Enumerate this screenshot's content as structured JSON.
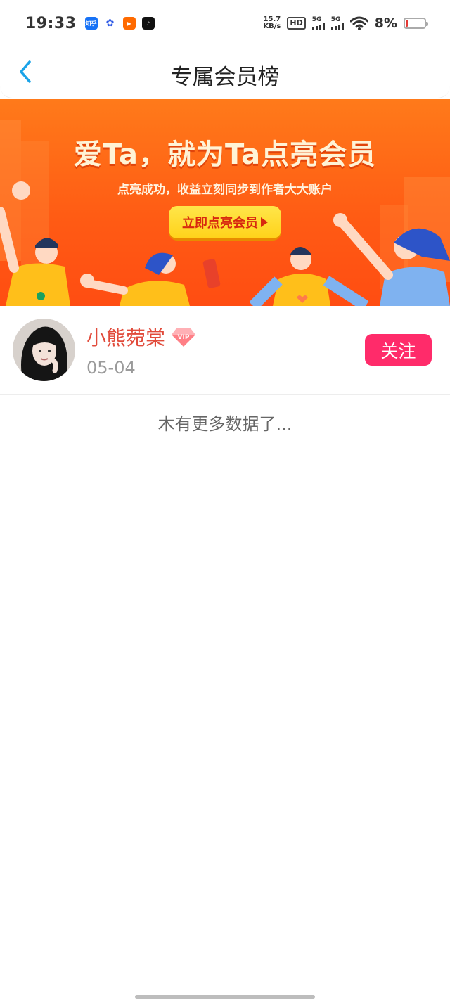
{
  "status_bar": {
    "time": "19:33",
    "app_icons": [
      {
        "name": "zhihu-app-icon",
        "glyph": "知乎",
        "color": "#1772f6"
      },
      {
        "name": "baidu-app-icon",
        "glyph": "✿",
        "color": "#2e5ae6"
      },
      {
        "name": "video-app-icon",
        "glyph": "▶",
        "color": "#ff6a00"
      },
      {
        "name": "tiktok-app-icon",
        "glyph": "♪",
        "color": "#111111"
      }
    ],
    "net_speed_value": "15.7",
    "net_speed_unit": "KB/s",
    "hd_label": "HD",
    "signal_1": "5G",
    "signal_2": "5G",
    "battery_percent": "8%"
  },
  "nav": {
    "title": "专属会员榜"
  },
  "banner": {
    "title": "爱Ta，就为Ta点亮会员",
    "subtitle": "点亮成功，收益立刻同步到作者大大账户",
    "cta_label": "立即点亮会员"
  },
  "members": [
    {
      "name": "小熊菀棠",
      "date": "05-04",
      "follow_label": "关注",
      "vip": "VIP"
    }
  ],
  "list_footer": "木有更多数据了...",
  "colors": {
    "accent_blue": "#1aa3e8",
    "name_red": "#e14b3b",
    "follow_pink": "#ff2b6a",
    "banner_orange": "#ff5a14"
  }
}
